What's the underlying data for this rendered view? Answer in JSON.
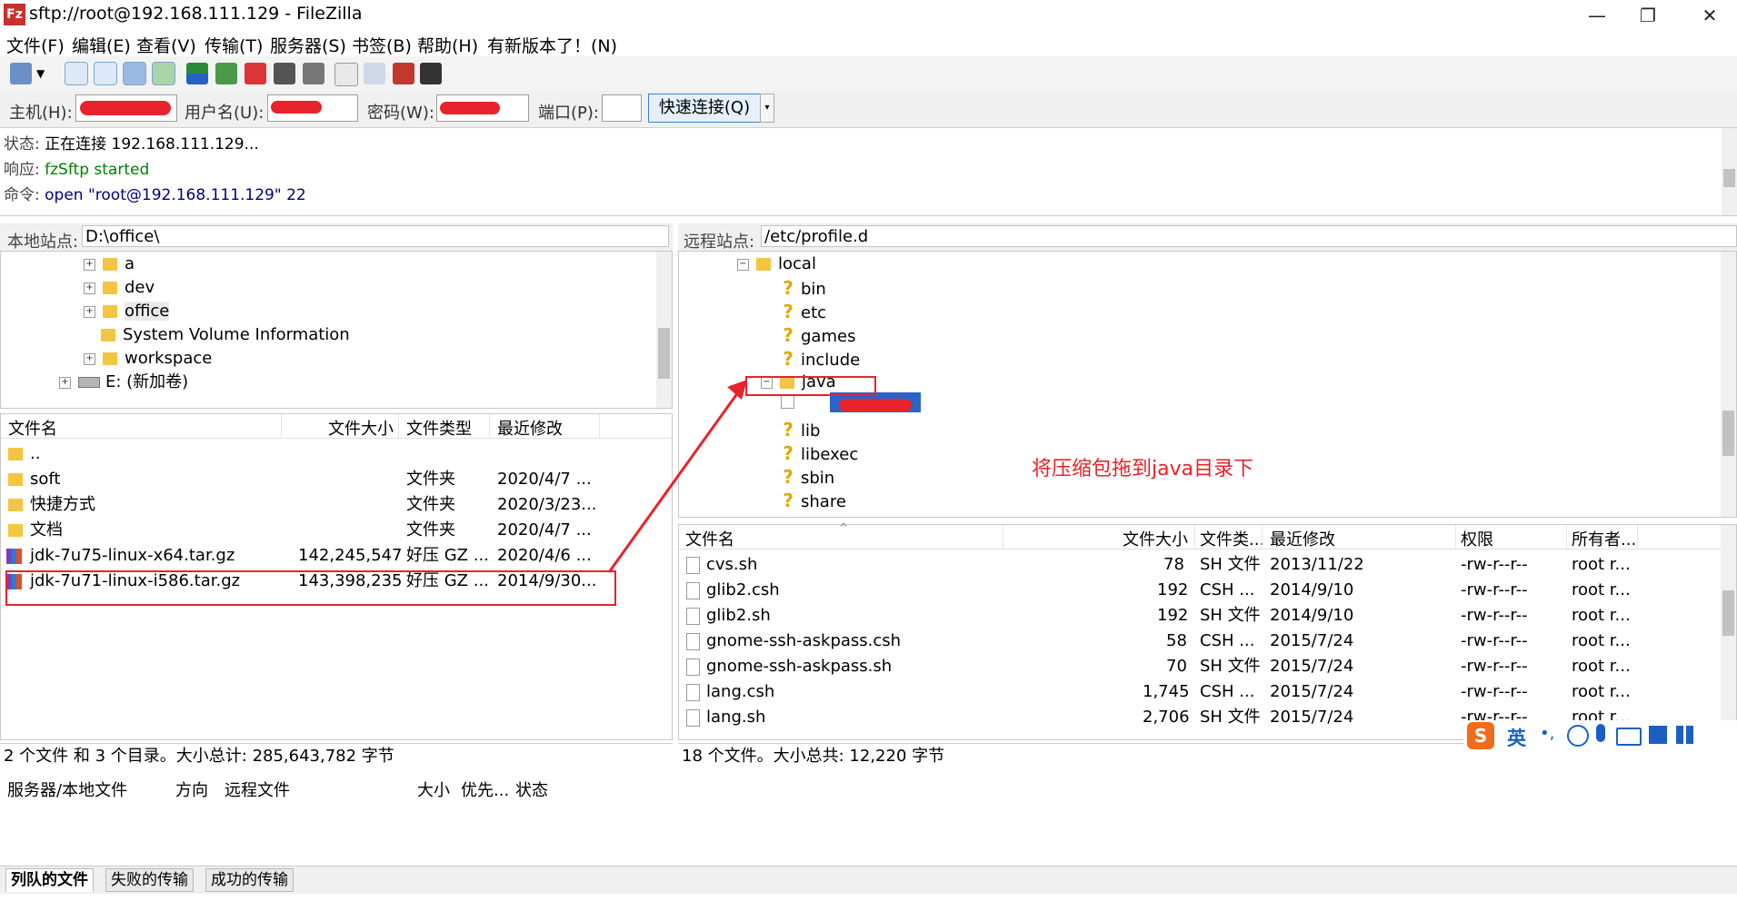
{
  "window": {
    "title": "sftp://root@192.168.111.129 - FileZilla",
    "icon_label": "Fz",
    "minimize": "—",
    "restore": "❐",
    "close": "✕"
  },
  "menu": [
    "文件(F)",
    "编辑(E)",
    "查看(V)",
    "传输(T)",
    "服务器(S)",
    "书签(B)",
    "帮助(H)",
    "有新版本了！(N)"
  ],
  "quickconnect": {
    "host_label": "主机(H):",
    "user_label": "用户名(U):",
    "pass_label": "密码(W):",
    "port_label": "端口(P):",
    "connect_label": "快速连接(Q)",
    "dropdown_icon": "▾"
  },
  "log": [
    {
      "prefix": "状态:",
      "text": "正在连接 192.168.111.129...",
      "color": "#000000"
    },
    {
      "prefix": "响应:",
      "text": "fzSftp started",
      "color": "#008000"
    },
    {
      "prefix": "命令:",
      "text": "open \"root@192.168.111.129\" 22",
      "color": "#00007f"
    }
  ],
  "local": {
    "site_label": "本地站点:",
    "site_path": "D:\\office\\",
    "tree": [
      "a",
      "dev",
      "office",
      "System Volume Information",
      "workspace",
      "E: (新加卷)"
    ],
    "columns": [
      "文件名",
      "文件大小",
      "文件类型",
      "最近修改"
    ],
    "files": [
      {
        "name": "..",
        "size": "",
        "type": "",
        "modified": ""
      },
      {
        "name": "soft",
        "size": "",
        "type": "文件夹",
        "modified": "2020/4/7 ..."
      },
      {
        "name": "快捷方式",
        "size": "",
        "type": "文件夹",
        "modified": "2020/3/23..."
      },
      {
        "name": "文档",
        "size": "",
        "type": "文件夹",
        "modified": "2020/4/7 ..."
      },
      {
        "name": "jdk-7u75-linux-x64.tar.gz",
        "size": "142,245,547",
        "type": "好压 GZ ...",
        "modified": "2020/4/6 ..."
      },
      {
        "name": "jdk-7u71-linux-i586.tar.gz",
        "size": "143,398,235",
        "type": "好压 GZ ...",
        "modified": "2014/9/30..."
      }
    ],
    "status": "2 个文件 和 3 个目录。大小总计: 285,643,782 字节"
  },
  "remote": {
    "site_label": "远程站点:",
    "site_path": "/etc/profile.d",
    "tree": [
      "local",
      "bin",
      "etc",
      "games",
      "include",
      "java",
      "lib",
      "libexec",
      "sbin",
      "share"
    ],
    "columns": [
      "文件名",
      "文件大小",
      "文件类...",
      "最近修改",
      "权限",
      "所有者..."
    ],
    "files": [
      {
        "name": "cvs.sh",
        "size": "78",
        "type": "SH 文件",
        "modified": "2013/11/22",
        "perms": "-rw-r--r--",
        "owner": "root r..."
      },
      {
        "name": "glib2.csh",
        "size": "192",
        "type": "CSH ...",
        "modified": "2014/9/10",
        "perms": "-rw-r--r--",
        "owner": "root r..."
      },
      {
        "name": "glib2.sh",
        "size": "192",
        "type": "SH 文件",
        "modified": "2014/9/10",
        "perms": "-rw-r--r--",
        "owner": "root r..."
      },
      {
        "name": "gnome-ssh-askpass.csh",
        "size": "58",
        "type": "CSH ...",
        "modified": "2015/7/24",
        "perms": "-rw-r--r--",
        "owner": "root r..."
      },
      {
        "name": "gnome-ssh-askpass.sh",
        "size": "70",
        "type": "SH 文件",
        "modified": "2015/7/24",
        "perms": "-rw-r--r--",
        "owner": "root r..."
      },
      {
        "name": "lang.csh",
        "size": "1,745",
        "type": "CSH ...",
        "modified": "2015/7/24",
        "perms": "-rw-r--r--",
        "owner": "root r..."
      },
      {
        "name": "lang.sh",
        "size": "2,706",
        "type": "SH 文件",
        "modified": "2015/7/24",
        "perms": "-rw-r--r--",
        "owner": "root r..."
      }
    ],
    "status": "18 个文件。大小总共: 12,220 字节"
  },
  "annotation": "将压缩包拖到java目录下",
  "queue": {
    "columns": [
      "服务器/本地文件",
      "方向",
      "远程文件",
      "大小",
      "优先...",
      "状态"
    ],
    "tabs": [
      "列队的文件",
      "失败的传输",
      "成功的传输"
    ]
  },
  "ime": {
    "logo": "S",
    "lang": "英"
  },
  "colors": {
    "accent_red": "#e8232b",
    "folder": "#f4c542",
    "selection": "#3c7fd2"
  }
}
